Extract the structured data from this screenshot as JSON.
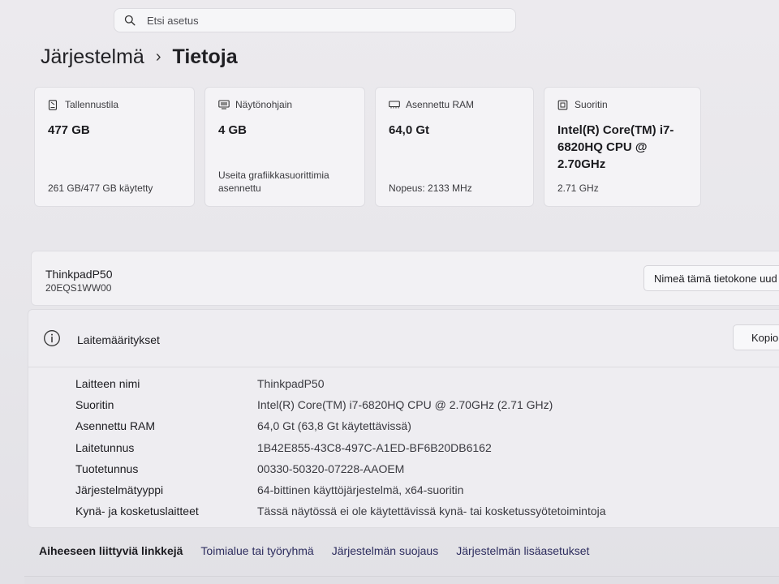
{
  "search": {
    "placeholder": "Etsi asetus"
  },
  "breadcrumb": {
    "parent": "Järjestelmä",
    "separator": "›",
    "current": "Tietoja"
  },
  "cards": [
    {
      "icon": "storage-icon",
      "title": "Tallennustila",
      "value": "477 GB",
      "footer": "261 GB/477 GB käytetty"
    },
    {
      "icon": "gpu-icon",
      "title": "Näytönohjain",
      "value": "4 GB",
      "footer": "Useita grafiikkasuorittimia asennettu"
    },
    {
      "icon": "ram-icon",
      "title": "Asennettu RAM",
      "value": "64,0 Gt",
      "footer": "Nopeus: 2133 MHz"
    },
    {
      "icon": "cpu-icon",
      "title": "Suoritin",
      "value": "Intel(R) Core(TM) i7-6820HQ CPU @ 2.70GHz",
      "footer": "2.71 GHz"
    }
  ],
  "device": {
    "name": "ThinkpadP50",
    "model": "20EQS1WW00",
    "rename_label": "Nimeä tämä tietokone uud"
  },
  "specs": {
    "title": "Laitemääritykset",
    "copy_label": "Kopio",
    "rows": [
      {
        "key": "Laitteen nimi",
        "value": "ThinkpadP50"
      },
      {
        "key": "Suoritin",
        "value": "Intel(R) Core(TM) i7-6820HQ CPU @ 2.70GHz (2.71 GHz)"
      },
      {
        "key": "Asennettu RAM",
        "value": "64,0 Gt (63,8 Gt käytettävissä)"
      },
      {
        "key": "Laitetunnus",
        "value": "1B42E855-43C8-497C-A1ED-BF6B20DB6162"
      },
      {
        "key": "Tuotetunnus",
        "value": "00330-50320-07228-AAOEM"
      },
      {
        "key": "Järjestelmätyyppi",
        "value": "64-bittinen käyttöjärjestelmä, x64-suoritin"
      },
      {
        "key": "Kynä- ja kosketuslaitteet",
        "value": "Tässä näytössä ei ole käytettävissä kynä- tai kosketussyötetoimintoja"
      }
    ]
  },
  "related": {
    "label": "Aiheeseen liittyviä linkkejä",
    "links": [
      "Toimialue tai työryhmä",
      "Järjestelmän suojaus",
      "Järjestelmän lisäasetukset"
    ]
  }
}
